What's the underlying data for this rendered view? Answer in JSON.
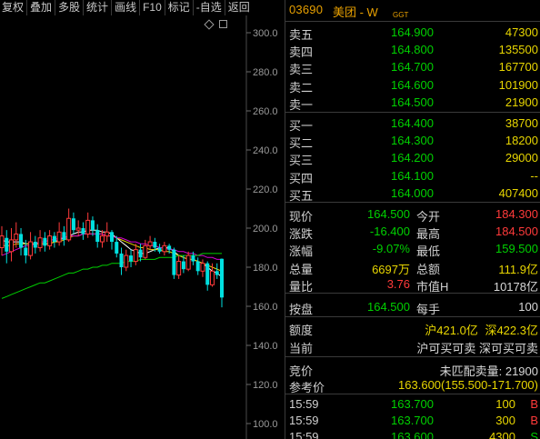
{
  "toolbar": {
    "items": [
      "复权",
      "叠加",
      "多股",
      "统计",
      "画线",
      "F10",
      "标记",
      "-自选",
      "返回"
    ]
  },
  "chart": {
    "y_ticks": [
      "300.0",
      "280.0",
      "260.0",
      "240.0",
      "220.0",
      "200.0",
      "180.0",
      "160.0",
      "140.0",
      "120.0",
      "100.0"
    ],
    "icons": [
      "diamond-icon",
      "square-icon"
    ]
  },
  "chart_data": {
    "type": "candlestick",
    "ylim": [
      100,
      300
    ],
    "candles": [
      {
        "o": 190,
        "c": 196,
        "h": 201,
        "l": 186
      },
      {
        "o": 195,
        "c": 188,
        "h": 199,
        "l": 182
      },
      {
        "o": 188,
        "c": 194,
        "h": 200,
        "l": 183
      },
      {
        "o": 194,
        "c": 197,
        "h": 203,
        "l": 190
      },
      {
        "o": 197,
        "c": 190,
        "h": 200,
        "l": 186
      },
      {
        "o": 190,
        "c": 186,
        "h": 194,
        "l": 182
      },
      {
        "o": 186,
        "c": 193,
        "h": 198,
        "l": 184
      },
      {
        "o": 193,
        "c": 190,
        "h": 196,
        "l": 187
      },
      {
        "o": 190,
        "c": 195,
        "h": 199,
        "l": 188
      },
      {
        "o": 195,
        "c": 191,
        "h": 198,
        "l": 188
      },
      {
        "o": 191,
        "c": 196,
        "h": 199,
        "l": 189
      },
      {
        "o": 196,
        "c": 193,
        "h": 198,
        "l": 190
      },
      {
        "o": 193,
        "c": 198,
        "h": 203,
        "l": 191
      },
      {
        "o": 198,
        "c": 194,
        "h": 201,
        "l": 191
      },
      {
        "o": 194,
        "c": 205,
        "h": 210,
        "l": 193
      },
      {
        "o": 205,
        "c": 199,
        "h": 208,
        "l": 197
      },
      {
        "o": 199,
        "c": 200,
        "h": 204,
        "l": 196
      },
      {
        "o": 200,
        "c": 197,
        "h": 203,
        "l": 194
      },
      {
        "o": 197,
        "c": 204,
        "h": 208,
        "l": 195
      },
      {
        "o": 204,
        "c": 199,
        "h": 206,
        "l": 196
      },
      {
        "o": 199,
        "c": 193,
        "h": 202,
        "l": 190
      },
      {
        "o": 193,
        "c": 196,
        "h": 199,
        "l": 190
      },
      {
        "o": 196,
        "c": 198,
        "h": 203,
        "l": 193
      },
      {
        "o": 198,
        "c": 193,
        "h": 199,
        "l": 189
      },
      {
        "o": 193,
        "c": 187,
        "h": 196,
        "l": 185
      },
      {
        "o": 187,
        "c": 180,
        "h": 190,
        "l": 176
      },
      {
        "o": 180,
        "c": 186,
        "h": 189,
        "l": 178
      },
      {
        "o": 186,
        "c": 183,
        "h": 189,
        "l": 180
      },
      {
        "o": 183,
        "c": 189,
        "h": 192,
        "l": 181
      },
      {
        "o": 189,
        "c": 185,
        "h": 192,
        "l": 183
      },
      {
        "o": 185,
        "c": 191,
        "h": 194,
        "l": 184
      },
      {
        "o": 191,
        "c": 193,
        "h": 196,
        "l": 189
      },
      {
        "o": 193,
        "c": 190,
        "h": 195,
        "l": 188
      },
      {
        "o": 190,
        "c": 188,
        "h": 192,
        "l": 187
      },
      {
        "o": 188,
        "c": 191,
        "h": 193,
        "l": 186
      },
      {
        "o": 191,
        "c": 189,
        "h": 192,
        "l": 187
      },
      {
        "o": 189,
        "c": 176,
        "h": 190,
        "l": 174
      },
      {
        "o": 176,
        "c": 183,
        "h": 186,
        "l": 174
      },
      {
        "o": 183,
        "c": 179,
        "h": 186,
        "l": 177
      },
      {
        "o": 179,
        "c": 186,
        "h": 188,
        "l": 178
      },
      {
        "o": 186,
        "c": 183,
        "h": 188,
        "l": 181
      },
      {
        "o": 183,
        "c": 178,
        "h": 185,
        "l": 176
      },
      {
        "o": 178,
        "c": 182,
        "h": 184,
        "l": 175
      },
      {
        "o": 182,
        "c": 171,
        "h": 183,
        "l": 168
      },
      {
        "o": 171,
        "c": 178,
        "h": 182,
        "l": 170
      },
      {
        "o": 178,
        "c": 176,
        "h": 182,
        "l": 174
      },
      {
        "o": 184.3,
        "c": 164.5,
        "h": 184.5,
        "l": 159.5
      }
    ],
    "ma_lines": [
      {
        "color": "#ffffff",
        "values": [
          194,
          193,
          193,
          193,
          193,
          192,
          192,
          192,
          192,
          192,
          192,
          193,
          194,
          195,
          196,
          197,
          198,
          198,
          199,
          199,
          199,
          198,
          198,
          197,
          195,
          193,
          191,
          189,
          188,
          187,
          187,
          188,
          189,
          190,
          190,
          190,
          188,
          186,
          185,
          184,
          184,
          183,
          182,
          180,
          178,
          177,
          175
        ]
      },
      {
        "color": "#e8d600",
        "values": [
          191,
          191,
          191,
          192,
          192,
          192,
          192,
          192,
          192,
          192,
          192,
          193,
          193,
          194,
          195,
          196,
          196,
          197,
          197,
          197,
          197,
          197,
          196,
          196,
          195,
          194,
          193,
          192,
          191,
          190,
          190,
          189,
          189,
          189,
          188,
          188,
          187,
          186,
          185,
          184,
          184,
          183,
          182,
          181,
          180,
          179,
          178
        ]
      },
      {
        "color": "#d200d2",
        "values": [
          186,
          187,
          188,
          189,
          190,
          191,
          191,
          192,
          193,
          193,
          194,
          194,
          195,
          195,
          196,
          196,
          196,
          197,
          197,
          197,
          197,
          197,
          196,
          196,
          195,
          195,
          194,
          193,
          193,
          192,
          192,
          191,
          191,
          190,
          190,
          189,
          189,
          188,
          188,
          187,
          187,
          186,
          186,
          185,
          185,
          184,
          184
        ]
      },
      {
        "color": "#00d000",
        "values": [
          164,
          165,
          166,
          167,
          168,
          169,
          170,
          171,
          172,
          172,
          173,
          174,
          175,
          176,
          177,
          177,
          178,
          179,
          179,
          180,
          180,
          181,
          181,
          182,
          182,
          182,
          183,
          183,
          183,
          184,
          184,
          184,
          184,
          185,
          185,
          185,
          185,
          186,
          186,
          186,
          186,
          186,
          187,
          187,
          187,
          187,
          187
        ]
      }
    ]
  },
  "header": {
    "code": "03690",
    "name": "美团 - W",
    "ggt": "GGT"
  },
  "asks": [
    {
      "label": "卖五",
      "price": "164.900",
      "vol": "47300"
    },
    {
      "label": "卖四",
      "price": "164.800",
      "vol": "135500"
    },
    {
      "label": "卖三",
      "price": "164.700",
      "vol": "167700"
    },
    {
      "label": "卖二",
      "price": "164.600",
      "vol": "101900"
    },
    {
      "label": "卖一",
      "price": "164.500",
      "vol": "21900"
    }
  ],
  "bids": [
    {
      "label": "买一",
      "price": "164.400",
      "vol": "38700"
    },
    {
      "label": "买二",
      "price": "164.300",
      "vol": "18200"
    },
    {
      "label": "买三",
      "price": "164.200",
      "vol": "29000"
    },
    {
      "label": "买四",
      "price": "164.100",
      "vol": "--"
    },
    {
      "label": "买五",
      "price": "164.000",
      "vol": "407400"
    }
  ],
  "stats": [
    {
      "l1": "现价",
      "v1": "164.500",
      "l2": "今开",
      "v2": "184.300",
      "c1": "green",
      "c2": "red"
    },
    {
      "l1": "涨跌",
      "v1": "-16.400",
      "l2": "最高",
      "v2": "184.500",
      "c1": "green",
      "c2": "red"
    },
    {
      "l1": "涨幅",
      "v1": "-9.07%",
      "l2": "最低",
      "v2": "159.500",
      "c1": "green",
      "c2": "green"
    },
    {
      "l1": "总量",
      "v1": "6697万",
      "l2": "总额",
      "v2": "111.9亿",
      "c1": "yellow",
      "c2": "yellow"
    },
    {
      "l1": "量比",
      "v1": "3.76",
      "l2": "市值H",
      "v2": "10178亿",
      "c1": "red",
      "c2": "white"
    }
  ],
  "lot": {
    "l1": "按盘",
    "v1": "164.500",
    "l2": "每手",
    "v2": "100"
  },
  "quota": {
    "label": "额度",
    "sh": "沪421.0亿",
    "sz": "深422.3亿"
  },
  "current": {
    "label": "当前",
    "value": "沪可买可卖 深可买可卖"
  },
  "auction": {
    "label": "竞价",
    "value": "未匹配卖量: 21900"
  },
  "ref": {
    "label": "参考价",
    "value": "163.600(155.500-171.700)"
  },
  "trades": [
    {
      "time": "15:59",
      "price": "163.700",
      "vol": "100",
      "dir": "B",
      "dcolor": "red"
    },
    {
      "time": "15:59",
      "price": "163.700",
      "vol": "300",
      "dir": "B",
      "dcolor": "red"
    },
    {
      "time": "15:59",
      "price": "163.600",
      "vol": "4300",
      "dir": "S",
      "dcolor": "green"
    }
  ]
}
